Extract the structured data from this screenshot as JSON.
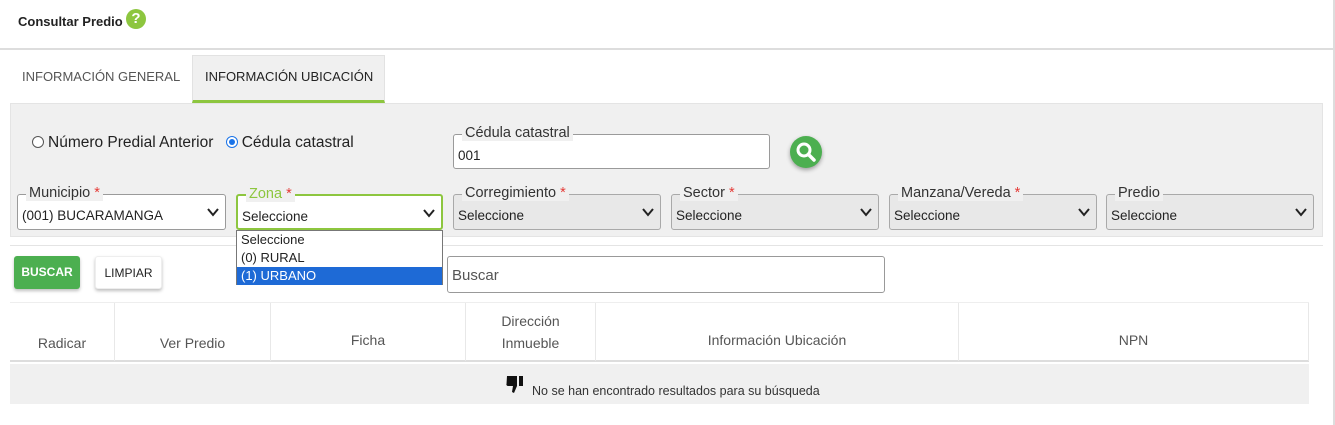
{
  "header": {
    "title": "Consultar Predio",
    "help_glyph": "?"
  },
  "tabs": [
    {
      "label": "INFORMACIÓN GENERAL",
      "active": false
    },
    {
      "label": "INFORMACIÓN UBICACIÓN",
      "active": true
    }
  ],
  "search_mode": {
    "options": [
      {
        "label": "Número Predial Anterior",
        "checked": false
      },
      {
        "label": "Cédula catastral",
        "checked": true
      }
    ]
  },
  "cedula": {
    "label": "Cédula catastral",
    "value": "001"
  },
  "filters": {
    "municipio": {
      "label": "Municipio",
      "required_mark": "*",
      "value": "(001) BUCARAMANGA"
    },
    "zona": {
      "label": "Zona",
      "required_mark": "*",
      "value": "Seleccione"
    },
    "corregimiento": {
      "label": "Corregimiento",
      "required_mark": "*",
      "value": "Seleccione"
    },
    "sector": {
      "label": "Sector",
      "required_mark": "*",
      "value": "Seleccione"
    },
    "manzana": {
      "label": "Manzana/Vereda",
      "required_mark": "*",
      "value": "Seleccione"
    },
    "predio": {
      "label": "Predio",
      "value": "Seleccione"
    }
  },
  "zona_dropdown": {
    "options": [
      "Seleccione",
      "(0) RURAL",
      "(1) URBANO"
    ],
    "highlighted": "(1) URBANO"
  },
  "actions": {
    "buscar": "BUSCAR",
    "limpiar": "LIMPIAR"
  },
  "table_search": {
    "placeholder": "Buscar"
  },
  "table": {
    "columns": [
      [
        "Radicar"
      ],
      [
        "Ver Predio"
      ],
      [
        "Ficha"
      ],
      [
        "Dirección",
        "Inmueble"
      ],
      [
        "Información Ubicación"
      ],
      [
        "NPN"
      ]
    ],
    "empty_message": "No se han encontrado resultados para su búsqueda"
  },
  "colors": {
    "accent_green": "#8dc63f",
    "button_green": "#4caf50",
    "selection_blue": "#1e6ad6",
    "required_red": "#e53935"
  },
  "icons": {
    "help": "question-circle-icon",
    "search": "magnifier-icon",
    "empty": "thumbs-down-icon",
    "select": "chevron-down-icon"
  }
}
